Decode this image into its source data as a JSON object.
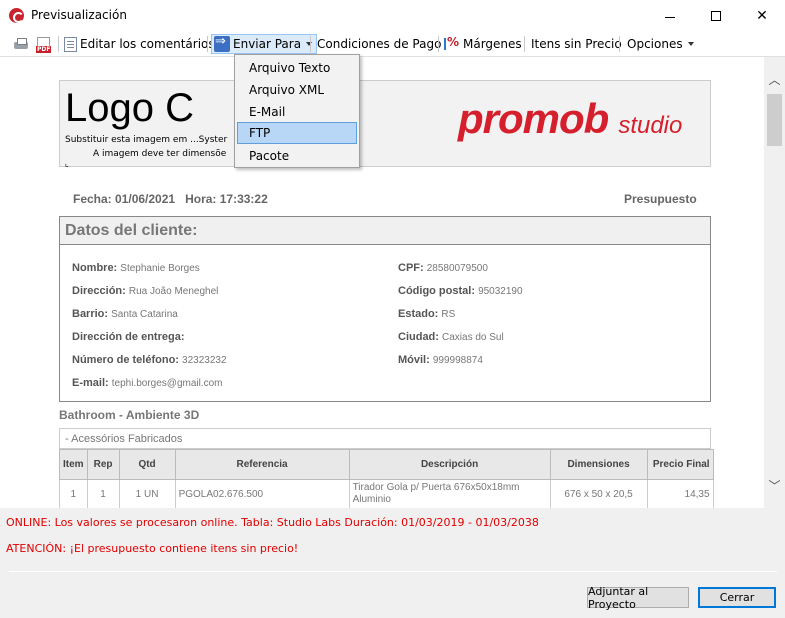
{
  "window": {
    "title": "Previsualización",
    "minimize": "—",
    "maximize": "☐",
    "close": "✕"
  },
  "toolbar": {
    "edit_comments": "Editar los comentários",
    "send_to": "Enviar Para",
    "payment_terms": "Condiciones de Pago",
    "margins": "Márgenes",
    "items_no_price": "Itens sin Precio",
    "options": "Opciones"
  },
  "send_menu": {
    "items": [
      "Arquivo Texto",
      "Arquivo XML",
      "E-Mail",
      "FTP",
      "Pacote"
    ],
    "highlighted": "FTP"
  },
  "document": {
    "logo_text": "Logo C",
    "logo_hint1": "Substituir esta imagem em ...Syster",
    "logo_hint2": "A imagem deve ter dimensõe",
    "brand_main": "promob",
    "brand_sub": "studio",
    "date_label": "Fecha: 01/06/2021   Hora: 17:33:22",
    "doc_type": "Presupuesto",
    "client": {
      "title": "Datos del cliente:",
      "nombre_label": "Nombre:",
      "nombre": "Stephanie Borges",
      "cpf_label": "CPF:",
      "cpf": "28580079500",
      "direccion_label": "Dirección:",
      "direccion": "Rua João Meneghel",
      "cp_label": "Código postal:",
      "cp": "95032190",
      "barrio_label": "Barrio:",
      "barrio": "Santa Catarina",
      "estado_label": "Estado:",
      "estado": "RS",
      "entrega_label": "Dirección de entrega:",
      "ciudad_label": "Ciudad:",
      "ciudad": "Caxias do Sul",
      "telefono_label": "Número de teléfono:",
      "telefono": "32323232",
      "movil_label": "Móvil:",
      "movil": "999998874",
      "email_label": "E-mail:",
      "email": "tephi.borges@gmail.com"
    },
    "ambient": "Bathroom - Ambiente 3D",
    "group": "- Acessórios Fabricados",
    "table": {
      "headers": [
        "Item",
        "Rep",
        "Qtd",
        "Referencia",
        "Descripción",
        "Dimensiones",
        "Precio Final"
      ],
      "rows": [
        [
          "1",
          "1",
          "1 UN",
          "PGOLA02.676.500",
          "Tirador Gola p/ Puerta 676x50x18mm Aluminio",
          "676 x 50 x 20,5",
          "14,35"
        ]
      ]
    }
  },
  "status": {
    "online": "ONLINE: Los valores se procesaron online. Tabla: Studio Labs Duración: 01/03/2019 - 01/03/2038",
    "warning": "ATENCIÓN: ¡El presupuesto contiene itens sin precio!"
  },
  "buttons": {
    "adjust": "Adjuntar al Proyecto",
    "close": "Cerrar"
  }
}
